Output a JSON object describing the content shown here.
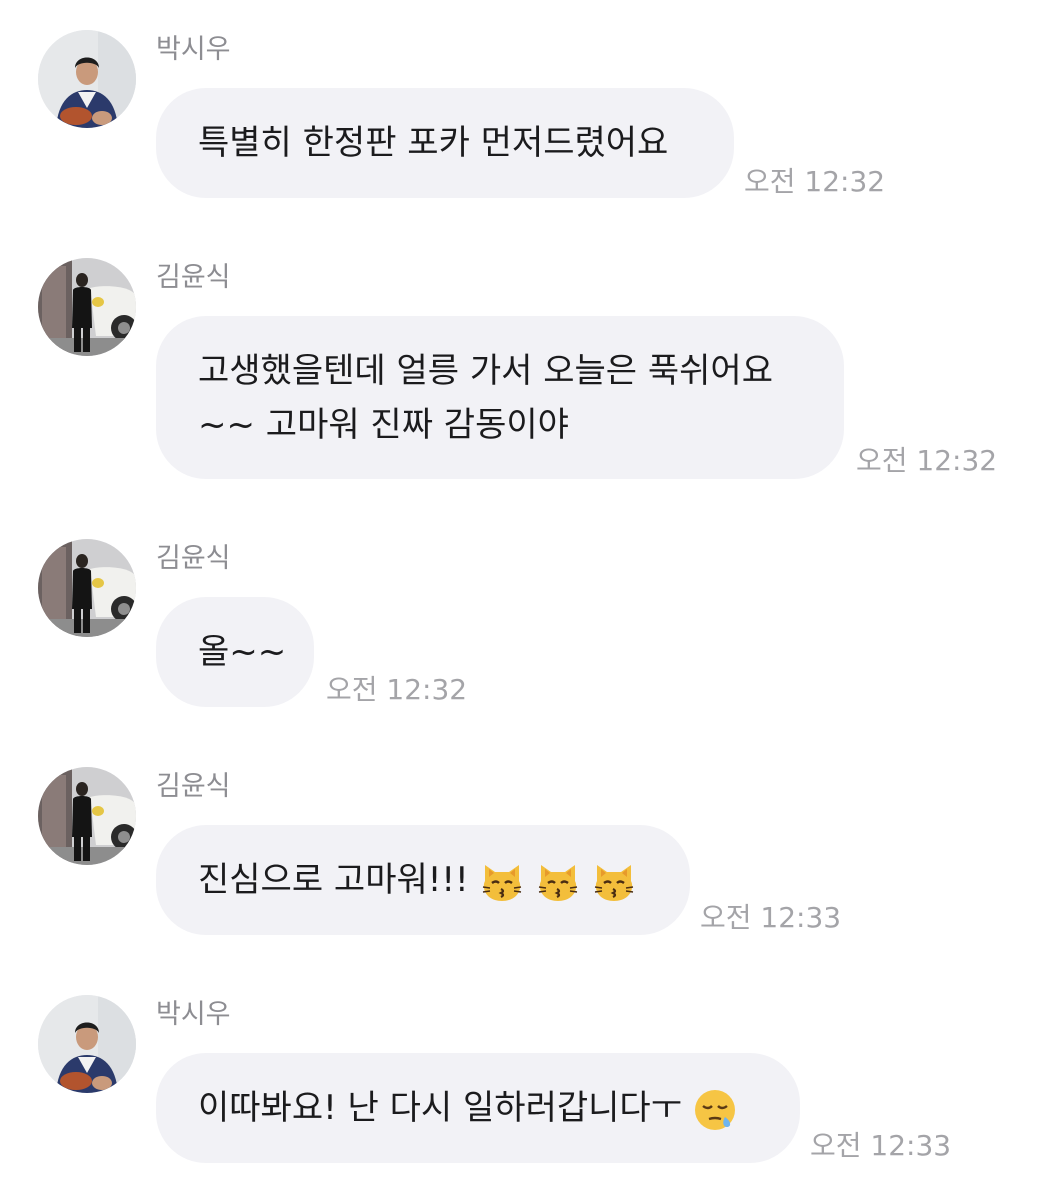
{
  "messages": [
    {
      "sender": "박시우",
      "avatar": "avatar-siwoo",
      "lines": [
        "특별히 한정판 포카 먼저드렸어요"
      ],
      "time": "오전 12:32"
    },
    {
      "sender": "김윤식",
      "avatar": "avatar-yunsik",
      "lines": [
        "고생했을텐데 얼릉 가서 오늘은 푹쉬어요",
        "~~ 고마워 진짜 감동이야"
      ],
      "time": "오전 12:32"
    },
    {
      "sender": "김윤식",
      "avatar": "avatar-yunsik",
      "lines": [
        "올~~"
      ],
      "time": "오전 12:32"
    },
    {
      "sender": "김윤식",
      "avatar": "avatar-yunsik",
      "lines": [
        "진심으로 고마워!!!"
      ],
      "emojis": [
        "kissing-cat-icon",
        "kissing-cat-icon",
        "kissing-cat-icon"
      ],
      "time": "오전 12:33"
    },
    {
      "sender": "박시우",
      "avatar": "avatar-siwoo",
      "lines": [
        "이따봐요! 난 다시 일하러갑니다ㅜ"
      ],
      "emojis": [
        "sleepy-face-icon"
      ],
      "time": "오전 12:33"
    }
  ],
  "colors": {
    "background": "#ffffff",
    "bubble": "#f2f2f6",
    "message_text": "#1b1b1d",
    "sender_text": "#8d8d92",
    "time_text": "#a4a4a8"
  }
}
